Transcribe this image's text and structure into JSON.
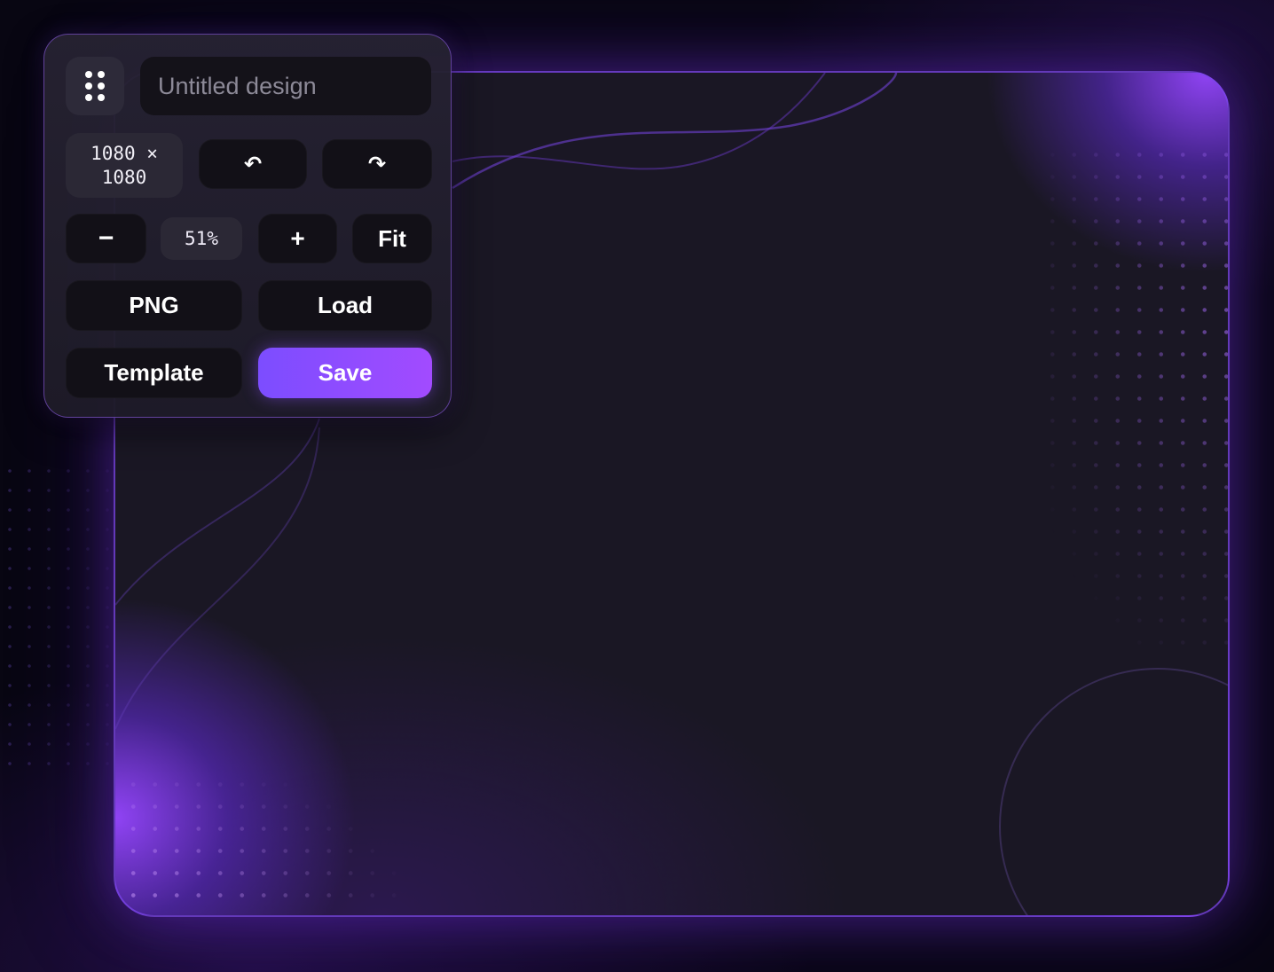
{
  "design": {
    "title_placeholder": "Untitled design",
    "size_label": "1080 × 1080"
  },
  "toolbar": {
    "grip_icon": "drag-grip-icon",
    "undo_label": "↶",
    "undo_icon": "undo-icon",
    "redo_label": "↷",
    "redo_icon": "redo-icon",
    "zoom_out_label": "−",
    "zoom_level": "51%",
    "zoom_in_label": "+",
    "fit_label": "Fit",
    "png_label": "PNG",
    "load_label": "Load",
    "template_label": "Template",
    "save_label": "Save"
  },
  "colors": {
    "accent": "#8b4dff",
    "canvas_bg": "#1a1724",
    "page_bg": "#080612",
    "button_bg": "#121017"
  }
}
